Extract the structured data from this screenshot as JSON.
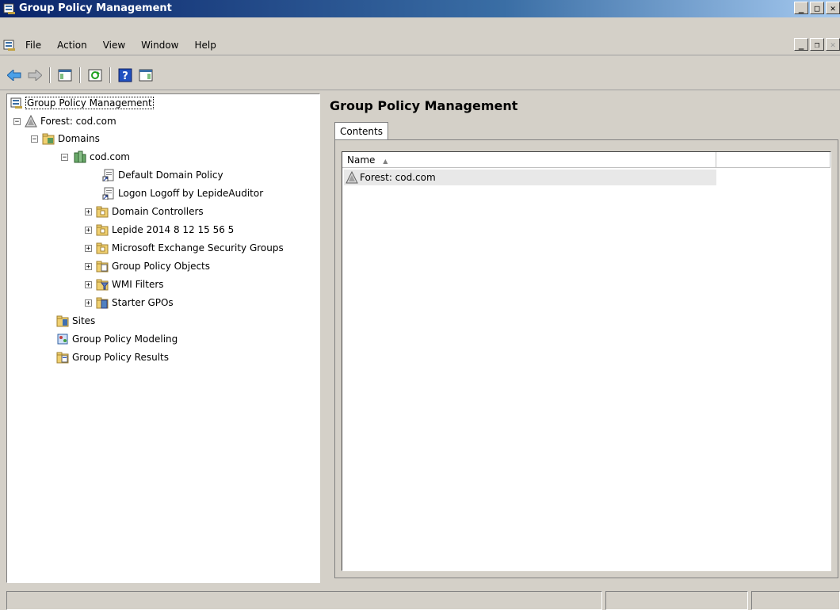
{
  "window": {
    "title": "Group Policy Management"
  },
  "menu": {
    "items": [
      {
        "label": "File"
      },
      {
        "label": "Action"
      },
      {
        "label": "View"
      },
      {
        "label": "Window"
      },
      {
        "label": "Help"
      }
    ]
  },
  "toolbar": {
    "buttons": [
      "back-arrow-icon",
      "forward-arrow-icon",
      "show-hide-tree-icon",
      "refresh-icon",
      "help-icon",
      "show-action-pane-icon"
    ]
  },
  "tree": {
    "root": "Group Policy Management",
    "forest": "Forest: cod.com",
    "domains": "Domains",
    "domain": "cod.com",
    "gpo1": "Default Domain Policy",
    "gpo2": "Logon Logoff by LepideAuditor",
    "ou1": "Domain Controllers",
    "ou2": "Lepide 2014 8 12 15 56 5",
    "ou3": "Microsoft Exchange Security Groups",
    "gpos": "Group Policy Objects",
    "wmi": "WMI Filters",
    "starter": "Starter GPOs",
    "sites": "Sites",
    "modeling": "Group Policy Modeling",
    "results": "Group Policy Results"
  },
  "right": {
    "title": "Group Policy Management",
    "tab": "Contents",
    "column_name": "Name",
    "sort_indicator": "▲",
    "rows": [
      "Forest: cod.com"
    ]
  },
  "colors": {
    "titlebar_start": "#0a246a",
    "titlebar_end": "#a6caf0",
    "chrome": "#d4d0c8"
  }
}
